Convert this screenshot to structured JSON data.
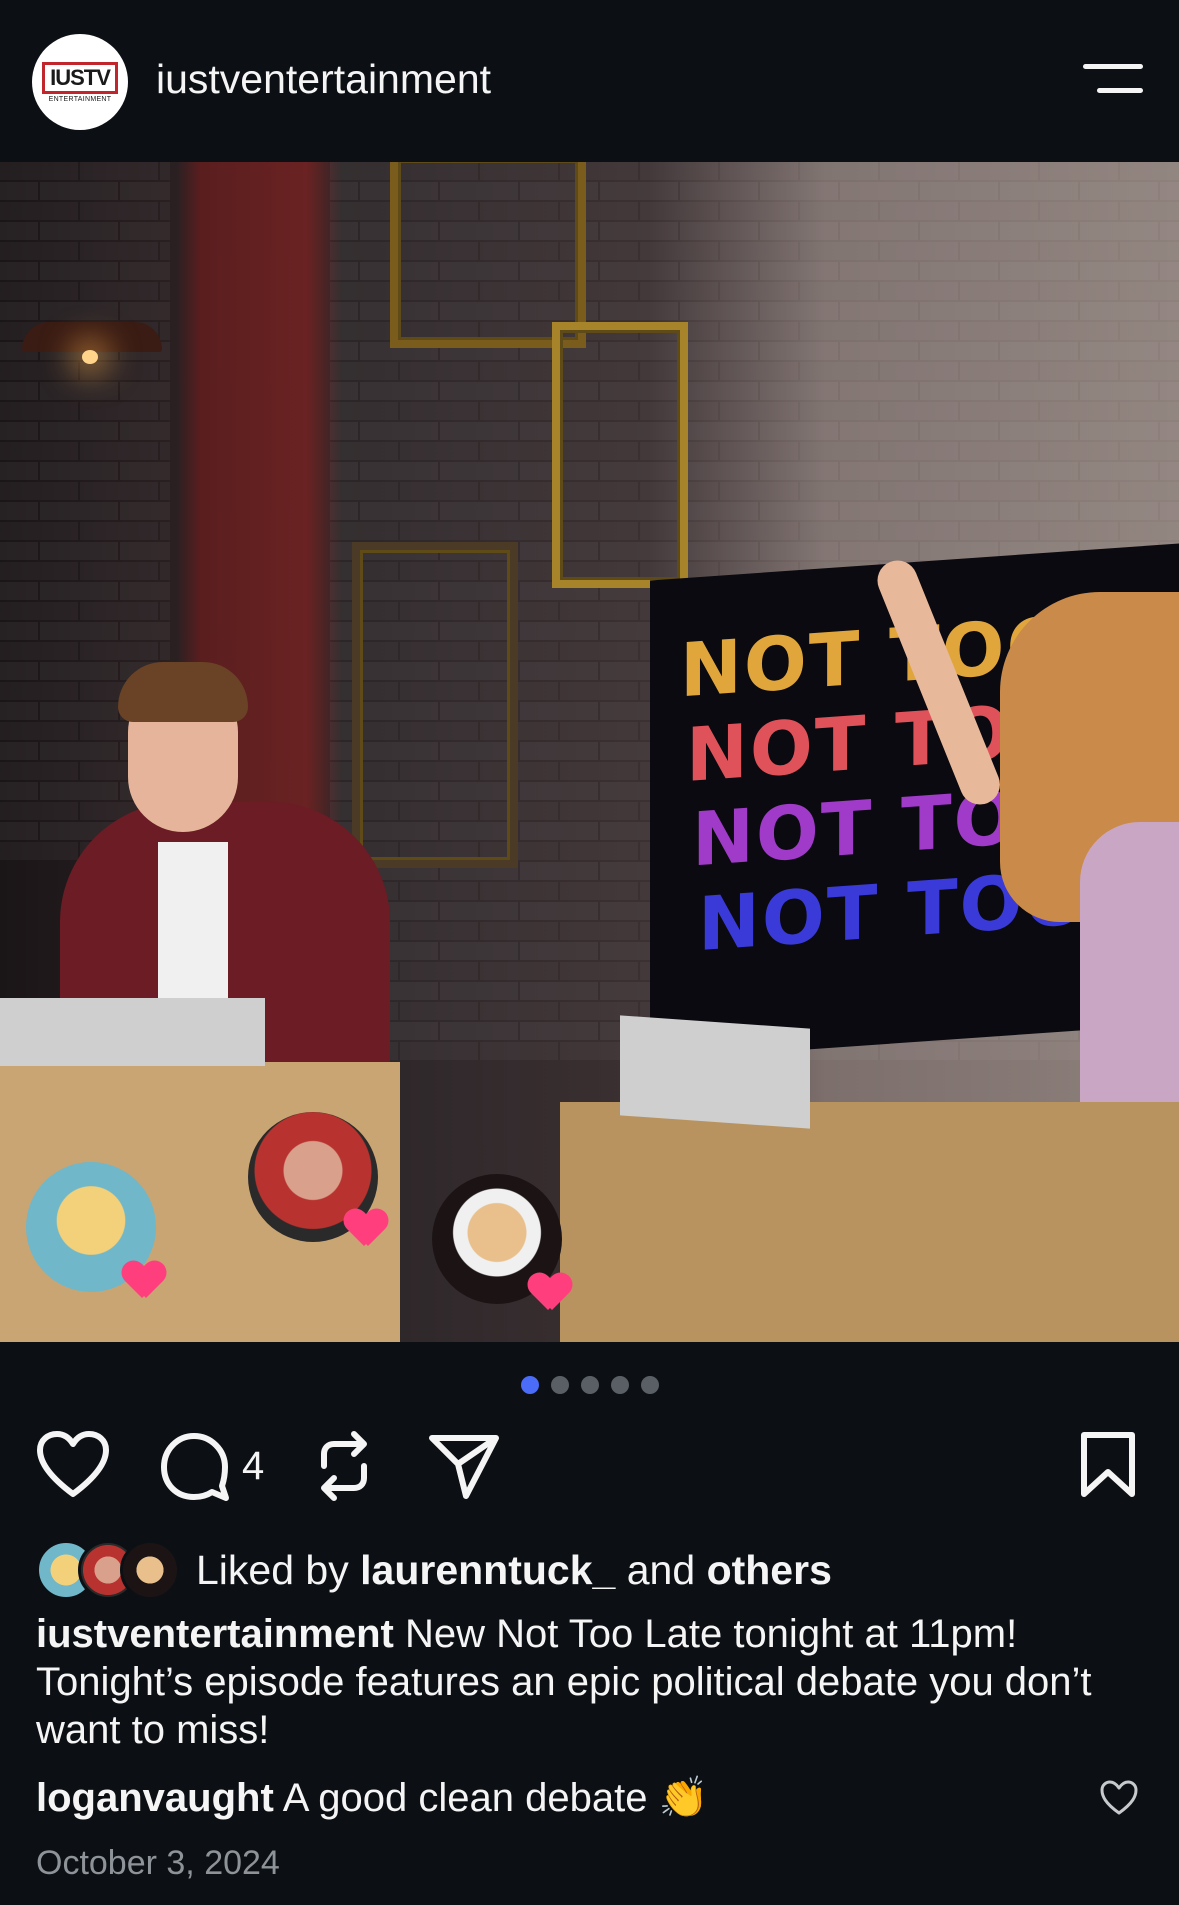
{
  "header": {
    "logo_text": "IUSTV",
    "logo_sub": "ENTERTAINMENT",
    "username": "iustventertainment",
    "menu_icon": "menu-icon"
  },
  "photo": {
    "screen_lines": [
      "NOT TOO",
      "NOT TOO",
      "NOT TOO L",
      "NOT TOO L"
    ],
    "screen_colors": [
      "#e0a63c",
      "#e0525a",
      "#a03ac8",
      "#3a3ad8"
    ],
    "carousel": {
      "count": 5,
      "active_index": 0
    }
  },
  "actions": {
    "like_icon": "heart-icon",
    "comment_icon": "comment-icon",
    "comment_count": "4",
    "repost_icon": "repost-icon",
    "share_icon": "send-icon",
    "save_icon": "bookmark-icon"
  },
  "likes": {
    "prefix": "Liked by",
    "user": "laurenntuck_",
    "middle": "and",
    "others": "others"
  },
  "caption": {
    "user": "iustventertainment",
    "text": "New Not Too Late tonight at 11pm! Tonight’s episode features an epic political debate you don’t want to miss!"
  },
  "top_comment": {
    "user": "loganvaught",
    "text": "A good clean debate",
    "emoji": "👏"
  },
  "date": "October 3, 2024"
}
